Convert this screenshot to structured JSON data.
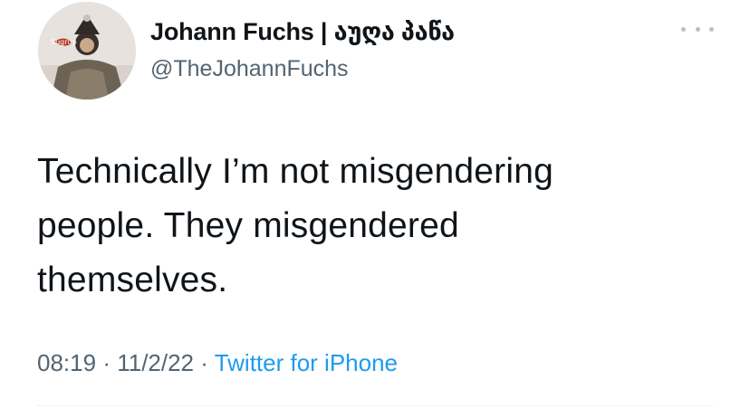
{
  "tweet": {
    "author": {
      "display_name": "Johann Fuchs | აუღა პაწა",
      "handle": "@TheJohannFuchs"
    },
    "text": "Technically I’m not misgendering\npeople. They misgendered\nthemselves.",
    "time": "08:19",
    "date": "11/2/22",
    "source": "Twitter for iPhone",
    "separator": "·"
  },
  "icons": {
    "more": "more-horizontal-icon"
  },
  "colors": {
    "text": "#0f1419",
    "secondary": "#536471",
    "link": "#1d9bf0"
  }
}
